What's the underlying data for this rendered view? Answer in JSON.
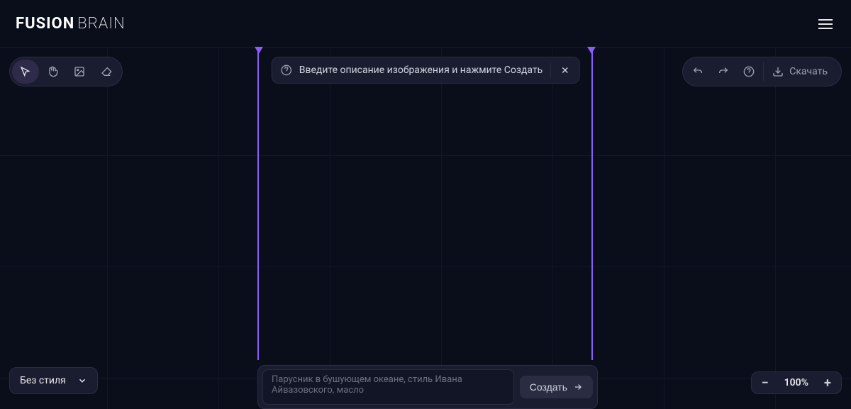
{
  "header": {
    "logo_bold": "FUSION",
    "logo_thin": "BRAIN"
  },
  "hint": {
    "text": "Введите описание изображения и нажмите Создать"
  },
  "toolbar_right": {
    "download_label": "Скачать"
  },
  "prompt": {
    "placeholder": "Парусник в бушующем океане, стиль Ивана Айвазовского, масло",
    "create_label": "Создать"
  },
  "style_dropdown": {
    "label": "Без стиля"
  },
  "zoom": {
    "value": "100%"
  },
  "colors": {
    "accent": "#8b5cf6",
    "bg": "#0a0d1a",
    "panel": "#1a1d30"
  }
}
